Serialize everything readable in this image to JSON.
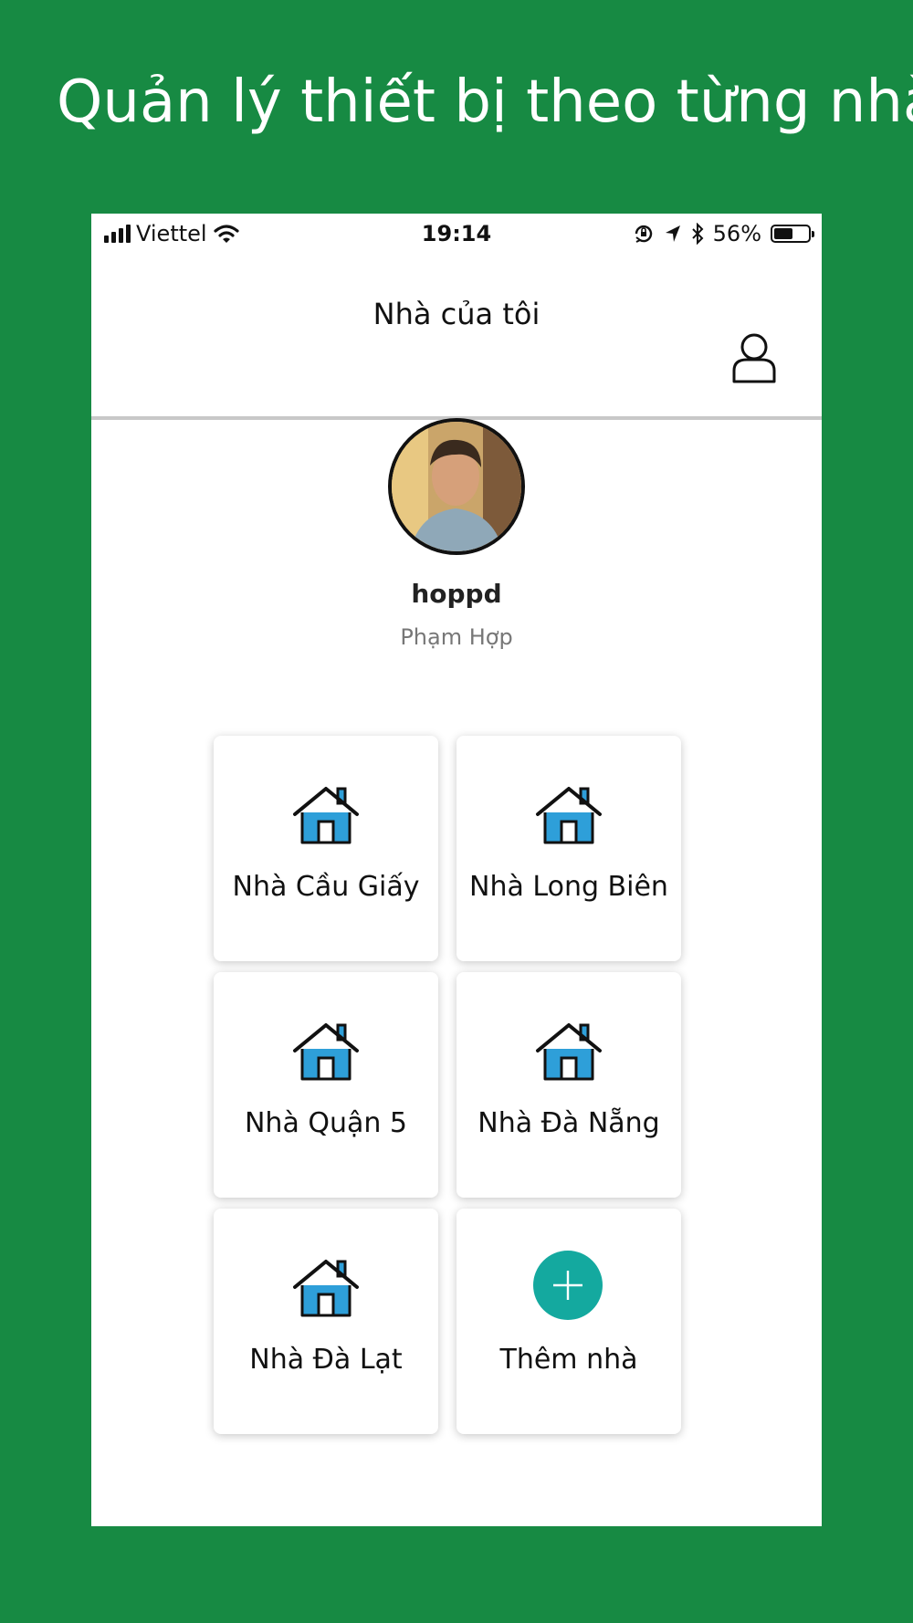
{
  "promo": {
    "title": "Quản lý thiết bị theo từng nhà"
  },
  "status_bar": {
    "carrier": "Viettel",
    "time": "19:14",
    "battery_percent": "56%",
    "battery_level": 0.56
  },
  "nav": {
    "title": "Nhà của tôi",
    "profile_icon": "user-icon"
  },
  "profile": {
    "username": "hoppd",
    "full_name": "Phạm Hợp"
  },
  "homes": [
    {
      "label": "Nhà Cầu Giấy",
      "icon": "house-icon"
    },
    {
      "label": "Nhà Long Biên",
      "icon": "house-icon"
    },
    {
      "label": "Nhà Quận 5",
      "icon": "house-icon"
    },
    {
      "label": "Nhà Đà Nẵng",
      "icon": "house-icon"
    },
    {
      "label": "Nhà Đà Lạt",
      "icon": "house-icon"
    }
  ],
  "add_home": {
    "label": "Thêm nhà",
    "icon": "plus-icon",
    "color": "#14a99f"
  },
  "colors": {
    "background": "#178a43",
    "house_fill": "#2e9fd9"
  }
}
